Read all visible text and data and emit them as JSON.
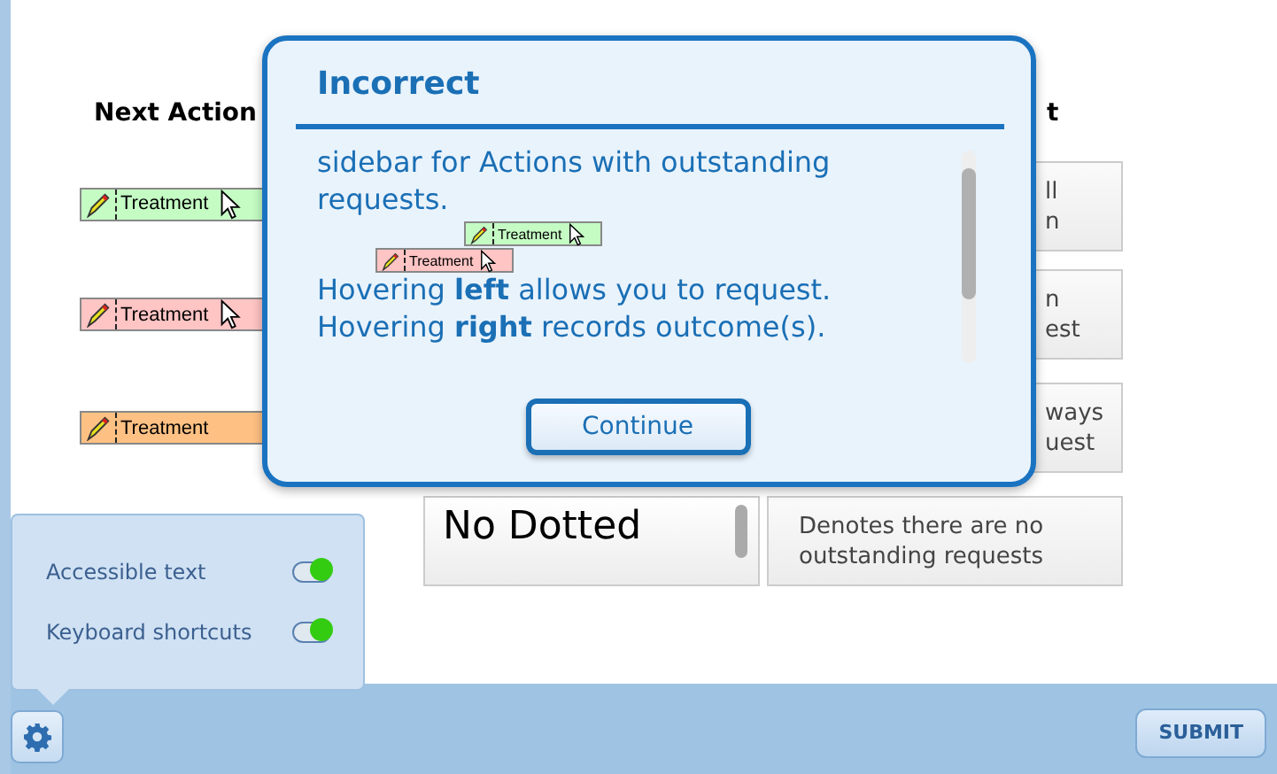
{
  "table": {
    "columns": [
      "Next Action",
      "t"
    ],
    "rows": [
      {
        "action": {
          "label": "Treatment",
          "color": "#c4fcc4",
          "cursor": true
        },
        "covered": true,
        "description": [
          "ll",
          "n"
        ]
      },
      {
        "action": {
          "label": "Treatment",
          "color": "#ffc4c4",
          "cursor": true
        },
        "covered": true,
        "description": [
          "n",
          "est"
        ]
      },
      {
        "action": {
          "label": "Treatment",
          "color": "#ffc183",
          "cursor": false
        },
        "covered": true,
        "description": [
          "ways",
          "uest"
        ]
      },
      {
        "status": "No Dotted",
        "covered": false,
        "description": [
          "Denotes there are no",
          "outstanding requests"
        ]
      }
    ]
  },
  "dialog": {
    "title": "Incorrect",
    "paragraphs": [
      "sidebar for Actions with outstanding requests.",
      "Hovering **left** allows you to request.  Hovering **right** records outcome(s)."
    ],
    "chips": [
      {
        "label": "Treatment",
        "color": "#c4fcc4",
        "cursor": true
      },
      {
        "label": "Treatment",
        "color": "#ffc4c4",
        "cursor": true
      }
    ],
    "button": "Continue"
  },
  "settings": {
    "items": [
      {
        "label": "Accessible text",
        "on": true
      },
      {
        "label": "Keyboard shortcuts",
        "on": true
      }
    ]
  },
  "submit": "SUBMIT"
}
